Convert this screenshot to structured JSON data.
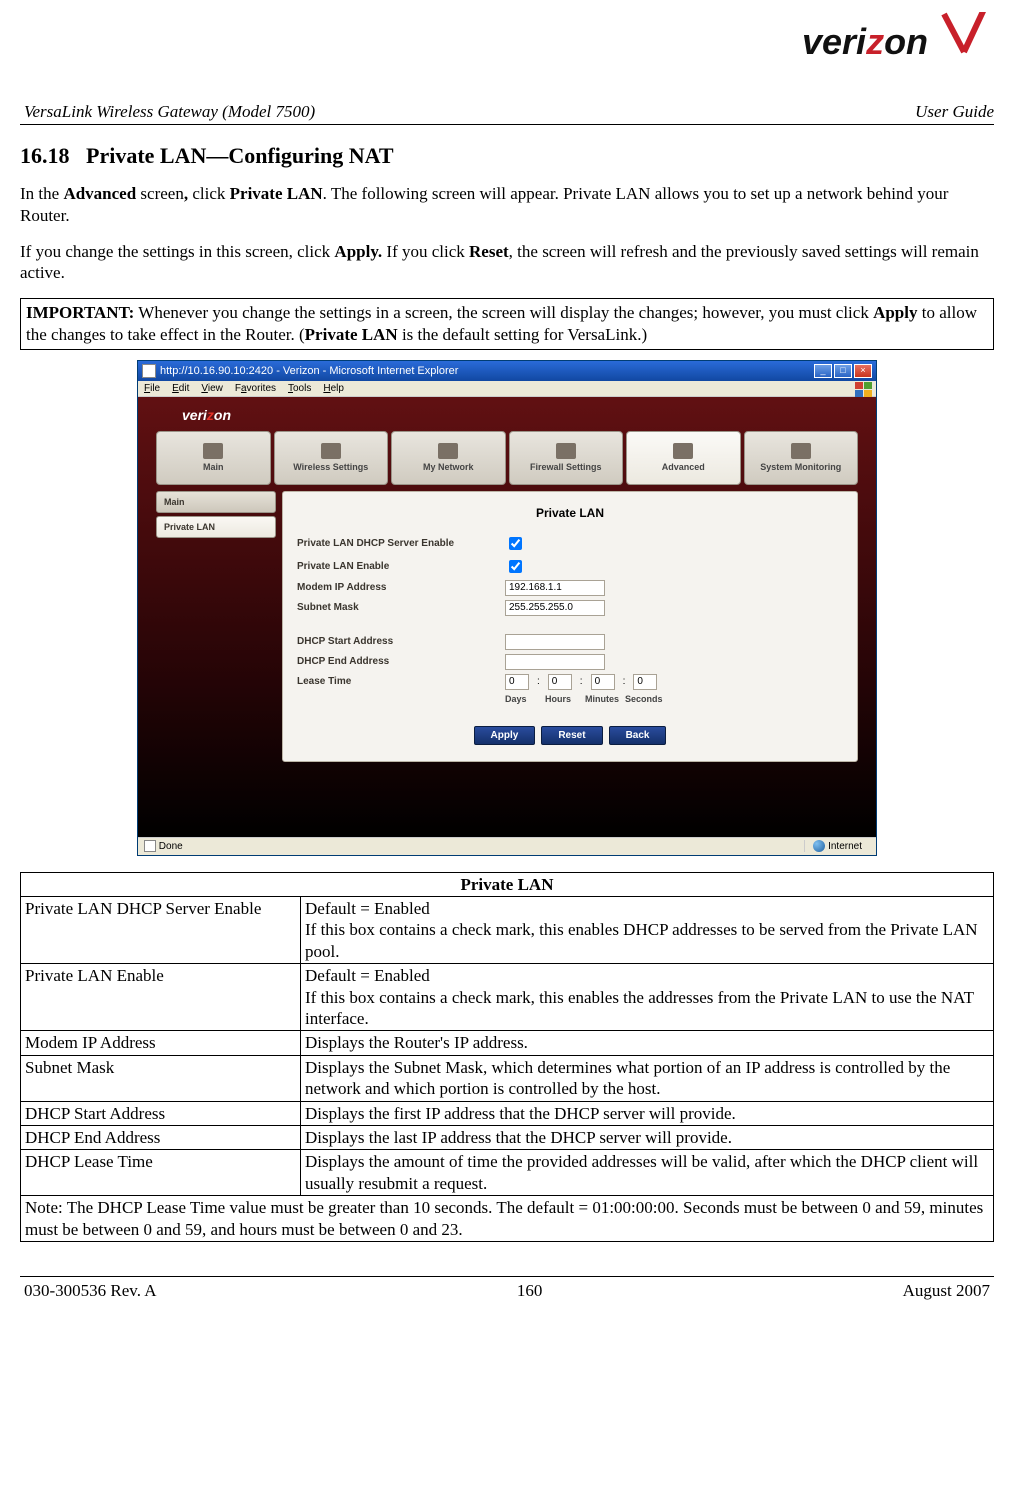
{
  "doc": {
    "product": "VersaLink Wireless Gateway (Model 7500)",
    "guide": "User Guide",
    "section_num": "16.18",
    "section_title": "Private LAN—Configuring NAT",
    "para1_a": "In the ",
    "para1_b": "Advanced",
    "para1_c": " screen",
    "para1_d": ",",
    "para1_e": " click ",
    "para1_f": "Private LAN",
    "para1_g": ". The following screen will appear. Private LAN allows you to set up a network behind your Router.",
    "para2_a": "If you change the settings in this screen, click ",
    "para2_b": "Apply.",
    "para2_c": " If you click ",
    "para2_d": "Reset",
    "para2_e": ", the screen will refresh and the previously saved settings will remain active.",
    "imp_a": "IMPORTANT:",
    "imp_b": " Whenever you change the settings in a screen, the screen will display the changes; however, you must click ",
    "imp_c": "Apply",
    "imp_d": " to allow the changes to take effect in the Router. (",
    "imp_e": "Private LAN",
    "imp_f": " is the default setting for VersaLink.)",
    "footer_left": "030-300536 Rev. A",
    "footer_center": "160",
    "footer_right": "August 2007"
  },
  "ie": {
    "title": "http://10.16.90.10:2420 - Verizon - Microsoft Internet Explorer",
    "menus": [
      "File",
      "Edit",
      "View",
      "Favorites",
      "Tools",
      "Help"
    ],
    "status_left": "Done",
    "status_right": "Internet"
  },
  "router": {
    "brand": "verizon",
    "tabs": [
      "Main",
      "Wireless Settings",
      "My Network",
      "Firewall Settings",
      "Advanced",
      "System Monitoring"
    ],
    "active_tab": 4,
    "side_tabs": [
      "Main",
      "Private LAN"
    ],
    "active_side": 1,
    "panel_title": "Private LAN",
    "fields": {
      "f1": "Private LAN DHCP Server Enable",
      "f2": "Private LAN Enable",
      "f3": "Modem IP Address",
      "f4": "Subnet Mask",
      "f5": "DHCP Start Address",
      "f6": "DHCP End Address",
      "f7": "Lease Time"
    },
    "values": {
      "modem_ip": "192.168.1.1",
      "subnet": "255.255.255.0",
      "dhcp_start": "",
      "dhcp_end": "",
      "days": "0",
      "hours": "0",
      "minutes": "0",
      "seconds": "0"
    },
    "lease_labels": [
      "Days",
      "Hours",
      "Minutes",
      "Seconds"
    ],
    "buttons": [
      "Apply",
      "Reset",
      "Back"
    ]
  },
  "table": {
    "header": "Private LAN",
    "rows": [
      {
        "l": "Private LAN DHCP Server Enable",
        "r": "Default = Enabled\nIf this box contains a check mark, this enables DHCP addresses to be served from the Private LAN pool."
      },
      {
        "l": "Private LAN Enable",
        "r": "Default = Enabled\nIf this box contains a check mark, this enables the addresses from the Private LAN to use the NAT interface."
      },
      {
        "l": "Modem IP Address",
        "r": "Displays the Router's IP address."
      },
      {
        "l": "Subnet Mask",
        "r": "Displays the Subnet Mask, which determines what portion of an IP address is controlled by the network and which portion is controlled by the host."
      },
      {
        "l": "DHCP Start Address",
        "r": "Displays the first IP address that the DHCP server will provide."
      },
      {
        "l": "DHCP End Address",
        "r": "Displays the last IP address that the DHCP server will provide."
      },
      {
        "l": "DHCP Lease Time",
        "r": "Displays the amount of time the provided addresses will be valid, after which the DHCP client will usually resubmit a request."
      }
    ],
    "note": "Note: The DHCP Lease Time value must be greater than 10 seconds. The default = 01:00:00:00. Seconds must be between 0 and 59, minutes must be between 0 and 59, and hours must be between 0 and 23."
  }
}
